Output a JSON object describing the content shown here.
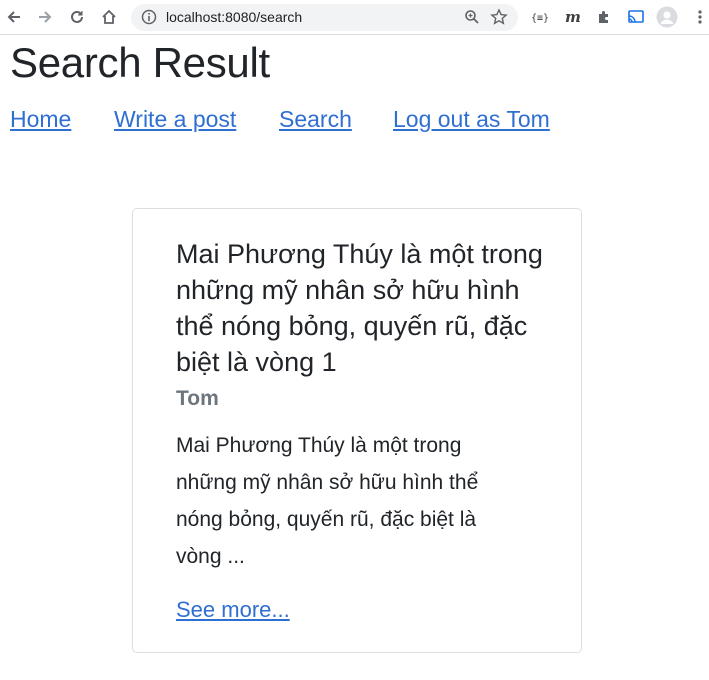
{
  "browser": {
    "url": "localhost:8080/search"
  },
  "page": {
    "title": "Search Result"
  },
  "nav": {
    "home": "Home",
    "write": "Write a post",
    "search": "Search",
    "logout": "Log out as Tom"
  },
  "result": {
    "title": "Mai Phương Thúy là một trong những mỹ nhân sở hữu hình thể nóng bỏng, quyến rũ, đặc biệt là vòng 1",
    "author": "Tom",
    "excerpt": "Mai Phương Thúy là một trong những mỹ nhân sở hữu hình thể nóng bỏng, quyến rũ, đặc biệt là vòng ...",
    "link": "See more..."
  },
  "colors": {
    "link": "#2f6fd1",
    "muted": "#6c757d",
    "text": "#212529"
  }
}
